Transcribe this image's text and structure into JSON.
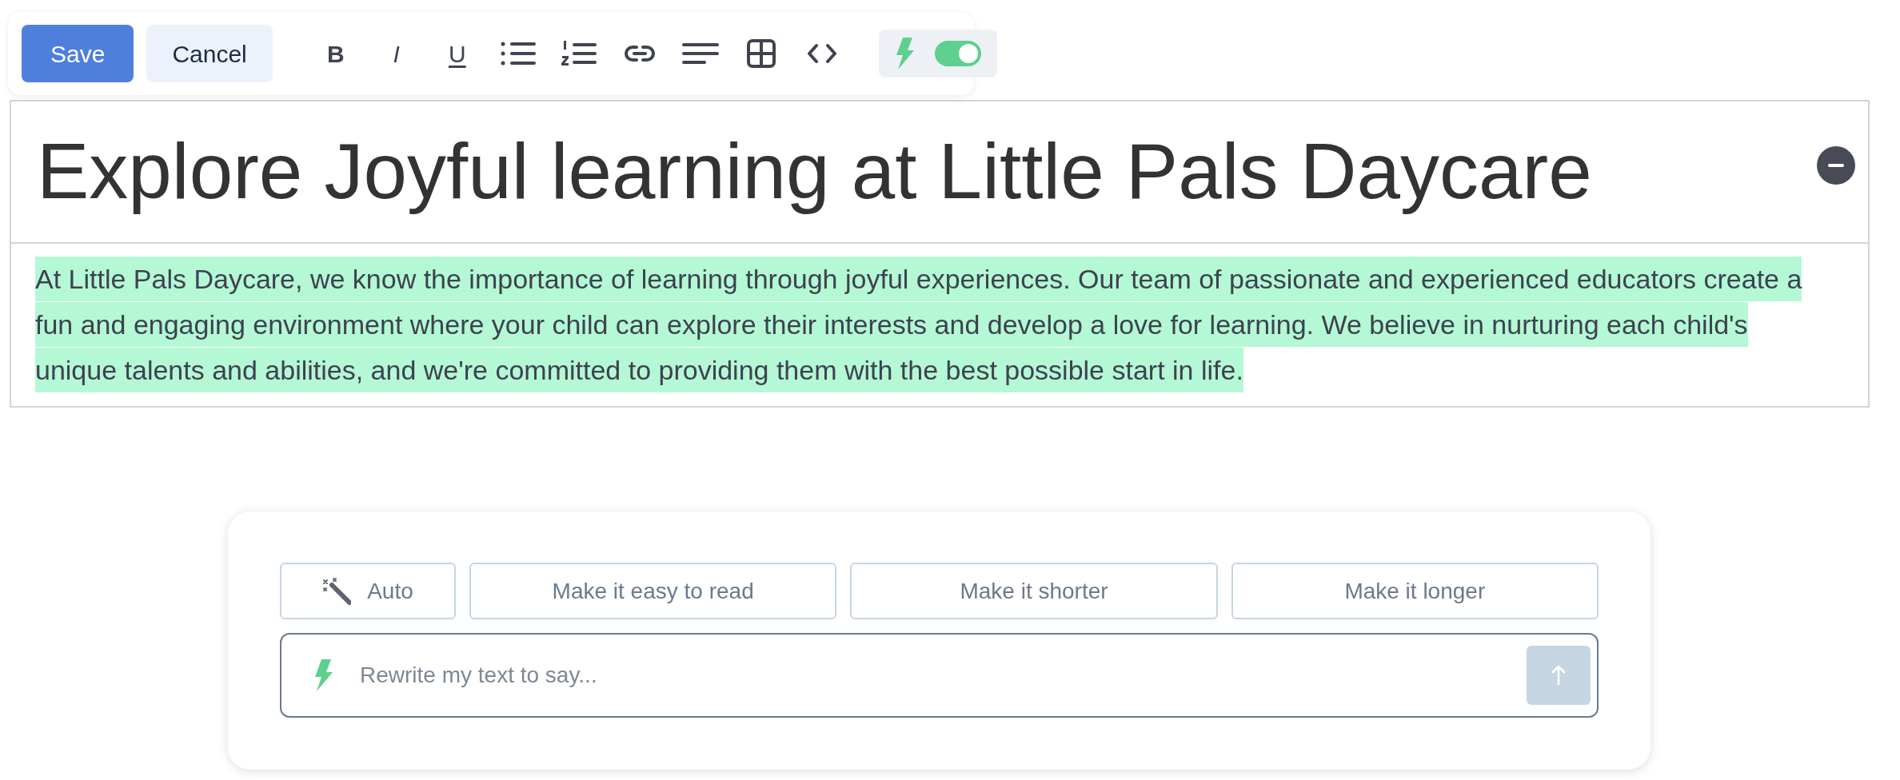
{
  "toolbar": {
    "save_button": "Save",
    "cancel_button": "Cancel",
    "format_buttons": [
      {
        "kind": "bold",
        "label": "B"
      },
      {
        "kind": "italic",
        "label": "I"
      },
      {
        "kind": "underline",
        "label": "U"
      },
      {
        "kind": "bullet-list"
      },
      {
        "kind": "numbered-list"
      },
      {
        "kind": "link"
      },
      {
        "kind": "align"
      },
      {
        "kind": "table"
      },
      {
        "kind": "code"
      }
    ],
    "ai_toggle": {
      "on": true
    }
  },
  "editor": {
    "heading": "Explore Joyful learning at Little Pals Daycare",
    "paragraph": "At Little Pals Daycare, we know the importance of learning through joyful experiences. Our team of passionate and experienced educators create a fun and engaging environment where your child can explore their interests and develop a love for learning. We believe in nurturing each child's unique talents and abilities, and we're committed to providing them with the best possible start in life.",
    "paragraph_highlighted": true
  },
  "ai_panel": {
    "suggestions": [
      {
        "kind": "auto",
        "label": "Auto"
      },
      {
        "kind": "plain",
        "label": "Make it easy to read"
      },
      {
        "kind": "plain",
        "label": "Make it shorter"
      },
      {
        "kind": "plain",
        "label": "Make it longer"
      }
    ],
    "prompt": {
      "placeholder": "Rewrite my text to say..."
    }
  }
}
